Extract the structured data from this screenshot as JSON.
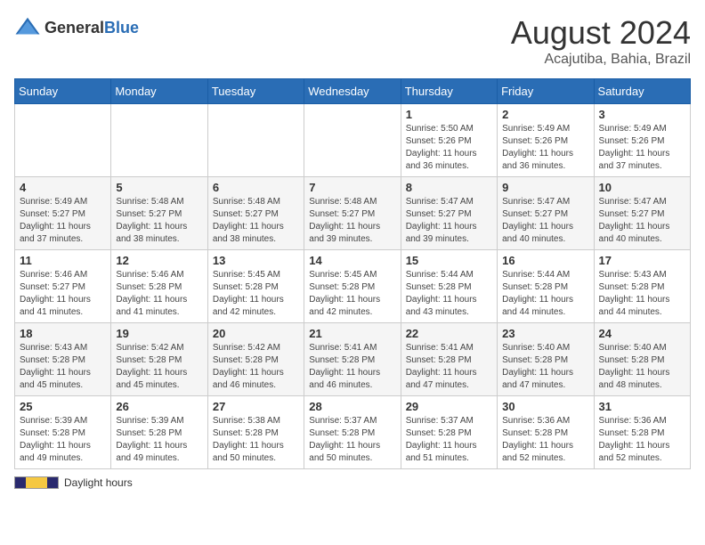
{
  "header": {
    "logo_general": "General",
    "logo_blue": "Blue",
    "title": "August 2024",
    "subtitle": "Acajutiba, Bahia, Brazil"
  },
  "days_of_week": [
    "Sunday",
    "Monday",
    "Tuesday",
    "Wednesday",
    "Thursday",
    "Friday",
    "Saturday"
  ],
  "weeks": [
    [
      {
        "day": "",
        "info": ""
      },
      {
        "day": "",
        "info": ""
      },
      {
        "day": "",
        "info": ""
      },
      {
        "day": "",
        "info": ""
      },
      {
        "day": "1",
        "info": "Sunrise: 5:50 AM\nSunset: 5:26 PM\nDaylight: 11 hours and 36 minutes."
      },
      {
        "day": "2",
        "info": "Sunrise: 5:49 AM\nSunset: 5:26 PM\nDaylight: 11 hours and 36 minutes."
      },
      {
        "day": "3",
        "info": "Sunrise: 5:49 AM\nSunset: 5:26 PM\nDaylight: 11 hours and 37 minutes."
      }
    ],
    [
      {
        "day": "4",
        "info": "Sunrise: 5:49 AM\nSunset: 5:27 PM\nDaylight: 11 hours and 37 minutes."
      },
      {
        "day": "5",
        "info": "Sunrise: 5:48 AM\nSunset: 5:27 PM\nDaylight: 11 hours and 38 minutes."
      },
      {
        "day": "6",
        "info": "Sunrise: 5:48 AM\nSunset: 5:27 PM\nDaylight: 11 hours and 38 minutes."
      },
      {
        "day": "7",
        "info": "Sunrise: 5:48 AM\nSunset: 5:27 PM\nDaylight: 11 hours and 39 minutes."
      },
      {
        "day": "8",
        "info": "Sunrise: 5:47 AM\nSunset: 5:27 PM\nDaylight: 11 hours and 39 minutes."
      },
      {
        "day": "9",
        "info": "Sunrise: 5:47 AM\nSunset: 5:27 PM\nDaylight: 11 hours and 40 minutes."
      },
      {
        "day": "10",
        "info": "Sunrise: 5:47 AM\nSunset: 5:27 PM\nDaylight: 11 hours and 40 minutes."
      }
    ],
    [
      {
        "day": "11",
        "info": "Sunrise: 5:46 AM\nSunset: 5:27 PM\nDaylight: 11 hours and 41 minutes."
      },
      {
        "day": "12",
        "info": "Sunrise: 5:46 AM\nSunset: 5:28 PM\nDaylight: 11 hours and 41 minutes."
      },
      {
        "day": "13",
        "info": "Sunrise: 5:45 AM\nSunset: 5:28 PM\nDaylight: 11 hours and 42 minutes."
      },
      {
        "day": "14",
        "info": "Sunrise: 5:45 AM\nSunset: 5:28 PM\nDaylight: 11 hours and 42 minutes."
      },
      {
        "day": "15",
        "info": "Sunrise: 5:44 AM\nSunset: 5:28 PM\nDaylight: 11 hours and 43 minutes."
      },
      {
        "day": "16",
        "info": "Sunrise: 5:44 AM\nSunset: 5:28 PM\nDaylight: 11 hours and 44 minutes."
      },
      {
        "day": "17",
        "info": "Sunrise: 5:43 AM\nSunset: 5:28 PM\nDaylight: 11 hours and 44 minutes."
      }
    ],
    [
      {
        "day": "18",
        "info": "Sunrise: 5:43 AM\nSunset: 5:28 PM\nDaylight: 11 hours and 45 minutes."
      },
      {
        "day": "19",
        "info": "Sunrise: 5:42 AM\nSunset: 5:28 PM\nDaylight: 11 hours and 45 minutes."
      },
      {
        "day": "20",
        "info": "Sunrise: 5:42 AM\nSunset: 5:28 PM\nDaylight: 11 hours and 46 minutes."
      },
      {
        "day": "21",
        "info": "Sunrise: 5:41 AM\nSunset: 5:28 PM\nDaylight: 11 hours and 46 minutes."
      },
      {
        "day": "22",
        "info": "Sunrise: 5:41 AM\nSunset: 5:28 PM\nDaylight: 11 hours and 47 minutes."
      },
      {
        "day": "23",
        "info": "Sunrise: 5:40 AM\nSunset: 5:28 PM\nDaylight: 11 hours and 47 minutes."
      },
      {
        "day": "24",
        "info": "Sunrise: 5:40 AM\nSunset: 5:28 PM\nDaylight: 11 hours and 48 minutes."
      }
    ],
    [
      {
        "day": "25",
        "info": "Sunrise: 5:39 AM\nSunset: 5:28 PM\nDaylight: 11 hours and 49 minutes."
      },
      {
        "day": "26",
        "info": "Sunrise: 5:39 AM\nSunset: 5:28 PM\nDaylight: 11 hours and 49 minutes."
      },
      {
        "day": "27",
        "info": "Sunrise: 5:38 AM\nSunset: 5:28 PM\nDaylight: 11 hours and 50 minutes."
      },
      {
        "day": "28",
        "info": "Sunrise: 5:37 AM\nSunset: 5:28 PM\nDaylight: 11 hours and 50 minutes."
      },
      {
        "day": "29",
        "info": "Sunrise: 5:37 AM\nSunset: 5:28 PM\nDaylight: 11 hours and 51 minutes."
      },
      {
        "day": "30",
        "info": "Sunrise: 5:36 AM\nSunset: 5:28 PM\nDaylight: 11 hours and 52 minutes."
      },
      {
        "day": "31",
        "info": "Sunrise: 5:36 AM\nSunset: 5:28 PM\nDaylight: 11 hours and 52 minutes."
      }
    ]
  ],
  "footer": {
    "daylight_label": "Daylight hours"
  }
}
